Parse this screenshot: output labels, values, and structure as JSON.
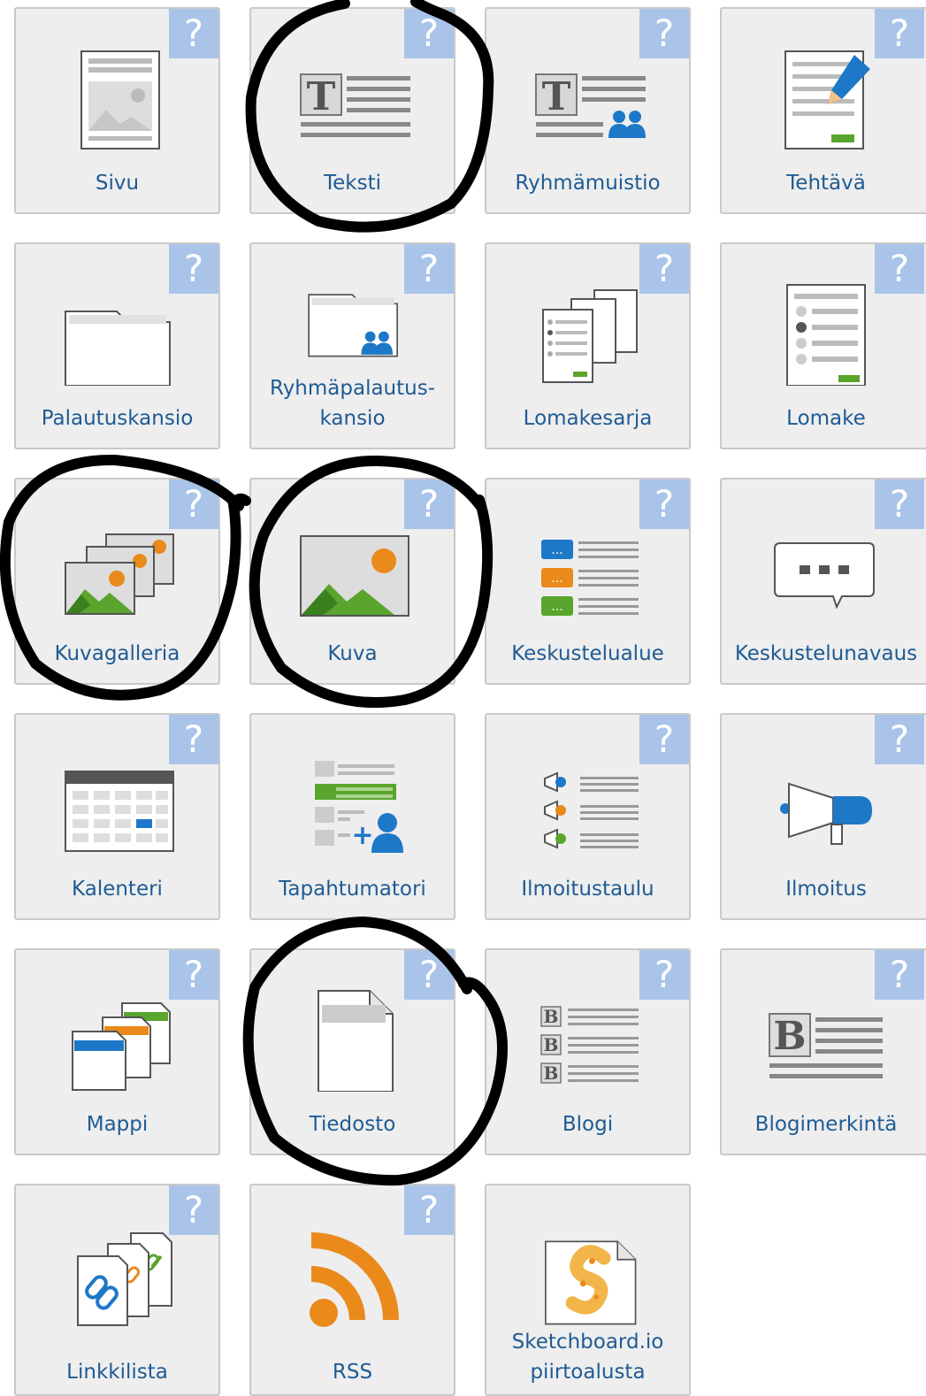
{
  "tiles": [
    {
      "label": "Sivu",
      "icon": "page-icon",
      "help": "?"
    },
    {
      "label": "Teksti",
      "icon": "text-icon",
      "help": "?"
    },
    {
      "label": "Ryhmämuistio",
      "icon": "group-notes-icon",
      "help": "?"
    },
    {
      "label": "Tehtävä",
      "icon": "assignment-icon",
      "help": "?"
    },
    {
      "label": "Palautuskansio",
      "icon": "folder-icon",
      "help": "?"
    },
    {
      "label": "Ryhmäpalautus-",
      "label2": "kansio",
      "icon": "group-folder-icon",
      "help": "?"
    },
    {
      "label": "Lomakesarja",
      "icon": "form-series-icon",
      "help": "?"
    },
    {
      "label": "Lomake",
      "icon": "form-icon",
      "help": "?"
    },
    {
      "label": "Kuvagalleria",
      "icon": "image-gallery-icon",
      "help": "?"
    },
    {
      "label": "Kuva",
      "icon": "image-icon",
      "help": "?"
    },
    {
      "label": "Keskustelualue",
      "icon": "discussion-area-icon",
      "help": "?"
    },
    {
      "label": "Keskustelunavaus",
      "icon": "discussion-topic-icon",
      "help": "?"
    },
    {
      "label": "Kalenteri",
      "icon": "calendar-icon",
      "help": "?"
    },
    {
      "label": "Tapahtumatori",
      "icon": "event-market-icon"
    },
    {
      "label": "Ilmoitustaulu",
      "icon": "notice-board-icon",
      "help": "?"
    },
    {
      "label": "Ilmoitus",
      "icon": "megaphone-icon",
      "help": "?"
    },
    {
      "label": "Mappi",
      "icon": "binder-icon",
      "help": "?"
    },
    {
      "label": "Tiedosto",
      "icon": "file-icon",
      "help": "?"
    },
    {
      "label": "Blogi",
      "icon": "blog-icon",
      "help": "?"
    },
    {
      "label": "Blogimerkintä",
      "icon": "blog-entry-icon",
      "help": "?"
    },
    {
      "label": "Linkkilista",
      "icon": "link-list-icon",
      "help": "?"
    },
    {
      "label": "RSS",
      "icon": "rss-icon",
      "help": "?"
    },
    {
      "label": "Sketchboard.io",
      "label2": "piirtoalusta",
      "icon": "sketchboard-icon"
    }
  ],
  "colors": {
    "tile_bg": "#eeeeee",
    "tile_border": "#c9c9c9",
    "help_bg": "#a9c4e8",
    "label": "#1f5b93",
    "blue": "#1e78c8",
    "green": "#5aa52d",
    "orange": "#e98a1b",
    "gray": "#8c8c8c",
    "annotation": "#000000"
  },
  "annotations": [
    {
      "shape": "hand-drawn-circle",
      "around": "Teksti"
    },
    {
      "shape": "hand-drawn-circle",
      "around": "Kuvagalleria"
    },
    {
      "shape": "hand-drawn-circle",
      "around": "Kuva"
    },
    {
      "shape": "hand-drawn-circle",
      "around": "Tiedosto"
    }
  ]
}
